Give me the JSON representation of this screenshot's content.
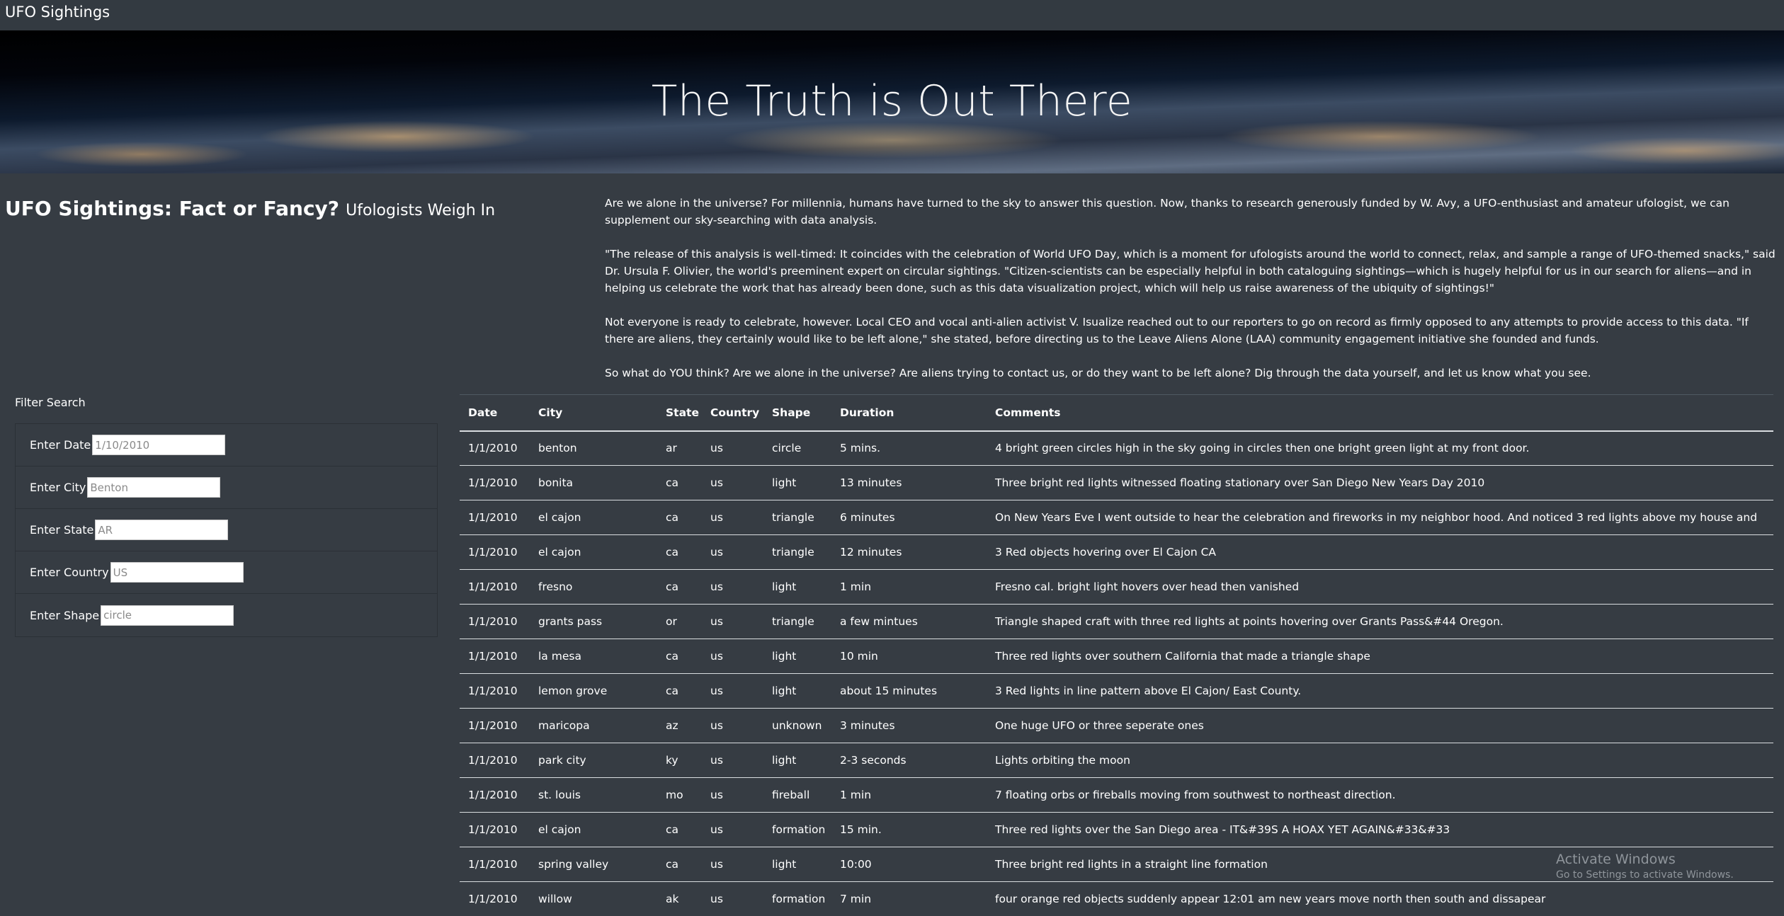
{
  "navbar": {
    "brand": "UFO Sightings"
  },
  "hero": {
    "title": "The Truth is Out There"
  },
  "article": {
    "headline": "UFO Sightings: Fact or Fancy?",
    "subheadline": "Ufologists Weigh In",
    "paragraphs": [
      "Are we alone in the universe? For millennia, humans have turned to the sky to answer this question. Now, thanks to research generously funded by W. Avy, a UFO-enthusiast and amateur ufologist, we can supplement our sky-searching with data analysis.",
      "\"The release of this analysis is well-timed: It coincides with the celebration of World UFO Day, which is a moment for ufologists around the world to connect, relax, and sample a range of UFO-themed snacks,\" said Dr. Ursula F. Olivier, the world's preeminent expert on circular sightings. \"Citizen-scientists can be especially helpful in both cataloguing sightings—which is hugely helpful for us in our search for aliens—and in helping us celebrate the work that has already been done, such as this data visualization project, which will help us raise awareness of the ubiquity of sightings!\"",
      "Not everyone is ready to celebrate, however. Local CEO and vocal anti-alien activist V. Isualize reached out to our reporters to go on record as firmly opposed to any attempts to provide access to this data. \"If there are aliens, they certainly would like to be left alone,\" she stated, before directing us to the Leave Aliens Alone (LAA) community engagement initiative she founded and funds.",
      "So what do YOU think? Are we alone in the universe? Are aliens trying to contact us, or do they want to be left alone? Dig through the data yourself, and let us know what you see."
    ]
  },
  "filters": {
    "title": "Filter Search",
    "fields": [
      {
        "label": "Enter Date",
        "placeholder": "1/10/2010"
      },
      {
        "label": "Enter City",
        "placeholder": "Benton"
      },
      {
        "label": "Enter State",
        "placeholder": "AR"
      },
      {
        "label": "Enter Country",
        "placeholder": "US"
      },
      {
        "label": "Enter Shape",
        "placeholder": "circle"
      }
    ]
  },
  "table": {
    "headers": [
      "Date",
      "City",
      "State",
      "Country",
      "Shape",
      "Duration",
      "Comments"
    ],
    "rows": [
      [
        "1/1/2010",
        "benton",
        "ar",
        "us",
        "circle",
        "5 mins.",
        "4 bright green circles high in the sky going in circles then one bright green light at my front door."
      ],
      [
        "1/1/2010",
        "bonita",
        "ca",
        "us",
        "light",
        "13 minutes",
        "Three bright red lights witnessed floating stationary over San Diego New Years Day 2010"
      ],
      [
        "1/1/2010",
        "el cajon",
        "ca",
        "us",
        "triangle",
        "6 minutes",
        "On New Years Eve I went outside to hear the celebration and fireworks in my neighbor hood. And noticed 3 red lights above my house and"
      ],
      [
        "1/1/2010",
        "el cajon",
        "ca",
        "us",
        "triangle",
        "12 minutes",
        "3 Red objects hovering over El Cajon CA"
      ],
      [
        "1/1/2010",
        "fresno",
        "ca",
        "us",
        "light",
        "1 min",
        "Fresno cal. bright light hovers over head then vanished"
      ],
      [
        "1/1/2010",
        "grants pass",
        "or",
        "us",
        "triangle",
        "a few mintues",
        "Triangle shaped craft with three red lights at points hovering over Grants Pass&#44 Oregon."
      ],
      [
        "1/1/2010",
        "la mesa",
        "ca",
        "us",
        "light",
        "10 min",
        "Three red lights over southern California that made a triangle shape"
      ],
      [
        "1/1/2010",
        "lemon grove",
        "ca",
        "us",
        "light",
        "about 15 minutes",
        "3 Red lights in line pattern above El Cajon/ East County."
      ],
      [
        "1/1/2010",
        "maricopa",
        "az",
        "us",
        "unknown",
        "3 minutes",
        "One huge UFO or three seperate ones"
      ],
      [
        "1/1/2010",
        "park city",
        "ky",
        "us",
        "light",
        "2-3 seconds",
        "Lights orbiting the moon"
      ],
      [
        "1/1/2010",
        "st. louis",
        "mo",
        "us",
        "fireball",
        "1 min",
        "7 floating orbs or fireballs moving from southwest to northeast direction."
      ],
      [
        "1/1/2010",
        "el cajon",
        "ca",
        "us",
        "formation",
        "15 min.",
        "Three red lights over the San Diego area - IT&#39S A HOAX YET AGAIN&#33&#33"
      ],
      [
        "1/1/2010",
        "spring valley",
        "ca",
        "us",
        "light",
        "10:00",
        "Three bright red lights in a straight line formation"
      ],
      [
        "1/1/2010",
        "willow",
        "ak",
        "us",
        "formation",
        "7 min",
        "four orange red objects suddenly appear 12:01 am new years move north then south and dissapear"
      ]
    ]
  },
  "watermark": {
    "line1": "Activate Windows",
    "line2": "Go to Settings to activate Windows."
  }
}
